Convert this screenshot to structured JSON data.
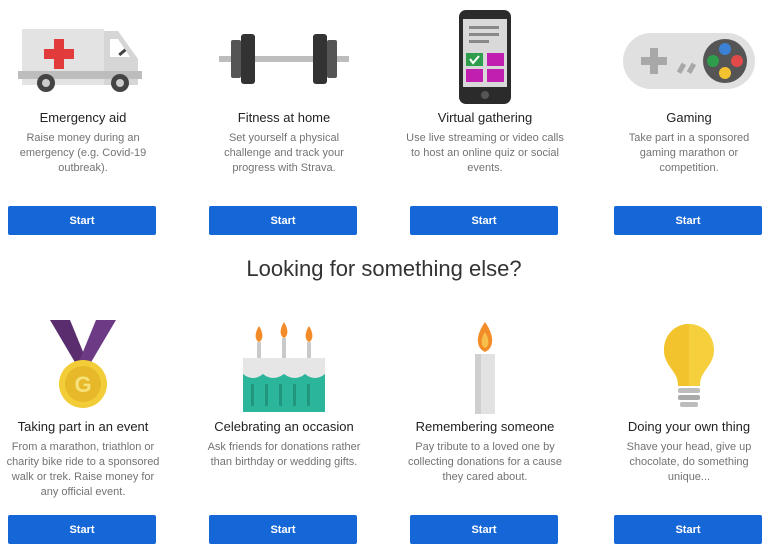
{
  "section_heading": "Looking for something else?",
  "cards_top": [
    {
      "title": "Emergency aid",
      "desc": "Raise money during an emergency (e.g. Covid-19 outbreak).",
      "button": "Start",
      "icon": "ambulance-icon"
    },
    {
      "title": "Fitness at home",
      "desc": "Set yourself a physical challenge and track your progress with Strava.",
      "button": "Start",
      "icon": "dumbbell-icon"
    },
    {
      "title": "Virtual gathering",
      "desc": "Use live streaming or video calls to host an online quiz or social events.",
      "button": "Start",
      "icon": "phone-icon"
    },
    {
      "title": "Gaming",
      "desc": "Take part in a sponsored gaming marathon or competition.",
      "button": "Start",
      "icon": "gamepad-icon"
    }
  ],
  "cards_bottom": [
    {
      "title": "Taking part in an event",
      "desc": "From a marathon, triathlon or charity bike ride to a sponsored walk or trek. Raise money for any official event.",
      "button": "Start",
      "icon": "medal-icon",
      "medal_letter": "G"
    },
    {
      "title": "Celebrating an occasion",
      "desc": "Ask friends for donations rather than birthday or wedding gifts.",
      "button": "Start",
      "icon": "birthday-cake-icon"
    },
    {
      "title": "Remembering someone",
      "desc": "Pay tribute to a loved one by collecting donations for a cause they cared about.",
      "button": "Start",
      "icon": "candle-icon"
    },
    {
      "title": "Doing your own thing",
      "desc": "Shave your head, give up chocolate, do something unique...",
      "button": "Start",
      "icon": "lightbulb-icon"
    }
  ]
}
